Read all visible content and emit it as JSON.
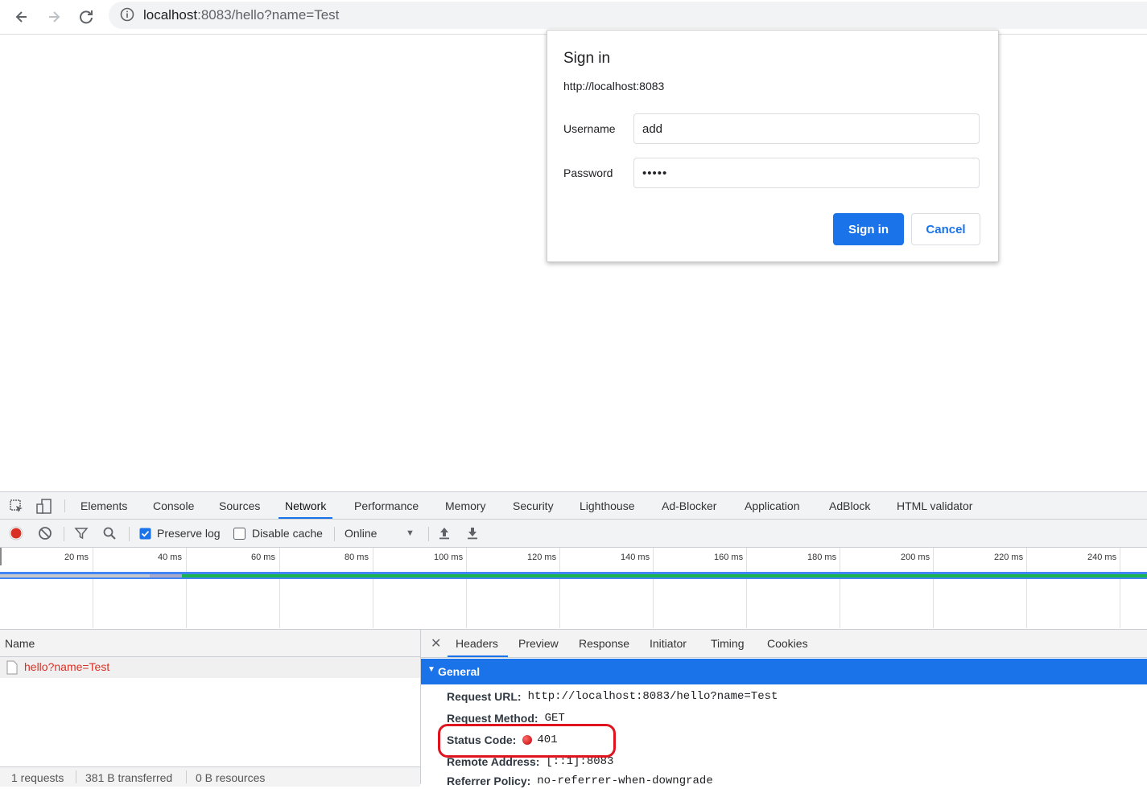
{
  "browser": {
    "url_host": "localhost",
    "url_rest": ":8083/hello?name=Test"
  },
  "dialog": {
    "title": "Sign in",
    "origin": "http://localhost:8083",
    "username_label": "Username",
    "username_value": "add",
    "password_label": "Password",
    "password_value": "•••••",
    "signin_label": "Sign in",
    "cancel_label": "Cancel"
  },
  "devtools": {
    "tabs": [
      "Elements",
      "Console",
      "Sources",
      "Network",
      "Performance",
      "Memory",
      "Security",
      "Lighthouse",
      "Ad-Blocker",
      "Application",
      "AdBlock",
      "HTML validator"
    ],
    "active_tab": "Network",
    "controls": {
      "preserve_log_label": "Preserve log",
      "preserve_log_checked": true,
      "disable_cache_label": "Disable cache",
      "disable_cache_checked": false,
      "throttle_value": "Online"
    },
    "timeline_ticks": [
      "20 ms",
      "40 ms",
      "60 ms",
      "80 ms",
      "100 ms",
      "120 ms",
      "140 ms",
      "160 ms",
      "180 ms",
      "200 ms",
      "220 ms",
      "240 ms"
    ],
    "name_header": "Name",
    "request_name": "hello?name=Test",
    "summary": {
      "requests": "1 requests",
      "transferred": "381 B transferred",
      "resources": "0 B resources"
    },
    "detail_tabs": [
      "Headers",
      "Preview",
      "Response",
      "Initiator",
      "Timing",
      "Cookies"
    ],
    "active_detail_tab": "Headers",
    "general_label": "General",
    "headers": {
      "request_url_key": "Request URL:",
      "request_url_val": "http://localhost:8083/hello?name=Test",
      "request_method_key": "Request Method:",
      "request_method_val": "GET",
      "status_code_key": "Status Code:",
      "status_code_val": "401",
      "remote_address_key": "Remote Address:",
      "remote_address_val": "[::1]:8083",
      "referrer_policy_key": "Referrer Policy:",
      "referrer_policy_val": "no-referrer-when-downgrade"
    },
    "colors": {
      "accent": "#1a73e8",
      "error_text": "#d93025",
      "highlight": "#e0141e"
    }
  }
}
